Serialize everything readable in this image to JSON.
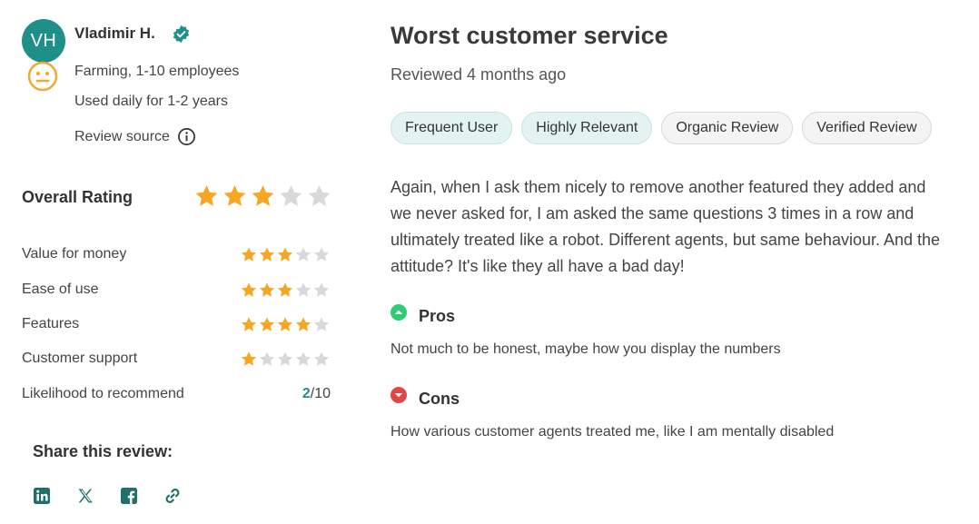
{
  "reviewer": {
    "initials": "VH",
    "name": "Vladimir H.",
    "industry": "Farming, 1-10 employees",
    "usage": "Used daily for 1-2 years",
    "review_source_label": "Review source",
    "avatar_color": "#1f8f8a",
    "mood_icon": "neutral-face-icon",
    "verified_icon": "verified-badge-icon"
  },
  "overall": {
    "label": "Overall Rating",
    "stars": 3,
    "max": 5
  },
  "ratings": [
    {
      "label": "Value for money",
      "stars": 3,
      "max": 5
    },
    {
      "label": "Ease of use",
      "stars": 3,
      "max": 5
    },
    {
      "label": "Features",
      "stars": 4,
      "max": 5
    },
    {
      "label": "Customer support",
      "stars": 1,
      "max": 5
    }
  ],
  "recommend": {
    "label": "Likelihood to recommend",
    "value": "2",
    "out_of": "/10"
  },
  "share": {
    "label": "Share this review:",
    "icons": [
      "linkedin-icon",
      "x-icon",
      "facebook-icon",
      "link-icon"
    ]
  },
  "review": {
    "title": "Worst customer service",
    "reviewed": "Reviewed 4 months ago",
    "tags": [
      "Frequent User",
      "Highly Relevant",
      "Organic Review",
      "Verified Review"
    ],
    "body": "Again, when I ask them nicely to remove another featured they added and we never asked for, I am asked the same questions 3 times in a row and ultimately treated like a robot. Different agents, but same behaviour. And the attitude? It's like they all have a bad day!",
    "pros_title": "Pros",
    "pros_text": "Not much to be honest, maybe how you display the numbers",
    "cons_title": "Cons",
    "cons_text": "How various customer agents treated me, like I am mentally disabled"
  },
  "colors": {
    "star_filled": "#f5a623",
    "star_empty": "#d9d9d9",
    "accent": "#1f8f8a",
    "pros": "#2ecc71",
    "cons": "#e04848"
  }
}
